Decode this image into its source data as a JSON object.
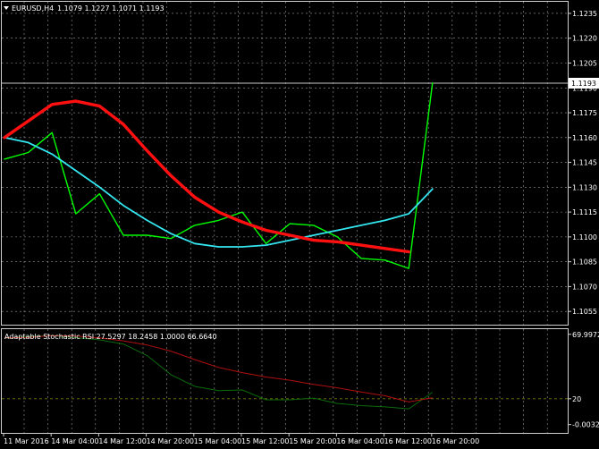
{
  "symbol_label": "EURUSD,H4",
  "ohlc_label": "1.1079 1.1227 1.1071 1.1193",
  "current_price_label": "1.1193",
  "indicator_title": "Adaptable Stochastic RSI 27.5297 18.2458 1.0000 66.6640",
  "colors": {
    "background": "#000000",
    "grid": "#9a9a9a",
    "price_line": "#00ff00",
    "cyan_ma": "#33e6f0",
    "red_ma": "#ff1010",
    "sub_green": "#0b6b0b",
    "sub_red": "#b01010",
    "level_line": "#7a7a00"
  },
  "chart_data": [
    {
      "type": "line",
      "title": "EURUSD,H4",
      "ylim": [
        1.1047,
        1.1242
      ],
      "y_ticks": [
        "1.1235",
        "1.1220",
        "1.1205",
        "1.1190",
        "1.1175",
        "1.1160",
        "1.1145",
        "1.1130",
        "1.1115",
        "1.1100",
        "1.1085",
        "1.1070",
        "1.1055"
      ],
      "series": [
        {
          "values": [
            1.1147,
            1.1151,
            1.1163,
            1.1114,
            1.1126,
            1.1101,
            1.1101,
            1.1099,
            1.1107,
            1.111,
            1.1115,
            1.1096,
            1.1108,
            1.1107,
            1.11,
            1.1087,
            1.1086,
            1.1081,
            1.1193
          ]
        },
        {
          "values": [
            1.116,
            1.1157,
            1.115,
            1.114,
            1.113,
            1.1119,
            1.111,
            1.1102,
            1.1096,
            1.1094,
            1.1094,
            1.1095,
            1.1098,
            1.1101,
            1.1104,
            1.1107,
            1.111,
            1.1114,
            1.1129
          ]
        },
        {
          "values": [
            1.116,
            1.117,
            1.118,
            1.1182,
            1.1179,
            1.1168,
            1.1152,
            1.1137,
            1.1124,
            1.1115,
            1.1109,
            1.1104,
            1.1101,
            1.1098,
            1.1097,
            1.1095,
            1.1093,
            1.1091
          ]
        }
      ]
    },
    {
      "type": "line",
      "title": "Adaptable Stochastic RSI 27.5297 18.2458 1.0000 66.6640",
      "ylim": [
        -6.5,
        74
      ],
      "y_ticks": [
        "69.9972",
        "20",
        "-0.0032"
      ],
      "levels": [
        20
      ],
      "series": [
        {
          "values": [
            67,
            68.3,
            68.9,
            67.4,
            65.7,
            62.5,
            53.5,
            38.7,
            29.6,
            26.3,
            26.8,
            19.2,
            19.2,
            20.5,
            16.3,
            14.7,
            13.7,
            12.2,
            25.0
          ]
        },
        {
          "values": [
            67.2,
            67.6,
            68.9,
            68.6,
            67.2,
            64.9,
            61.7,
            56.9,
            50.4,
            44.3,
            40.3,
            36.9,
            34.4,
            31.2,
            28.5,
            25.2,
            22.3,
            17.5,
            20.8
          ]
        }
      ]
    }
  ],
  "x_tick_labels": [
    "11 Mar 2016",
    "14 Mar 04:00",
    "14 Mar 12:00",
    "14 Mar 20:00",
    "15 Mar 04:00",
    "15 Mar 12:00",
    "15 Mar 20:00",
    "16 Mar 04:00",
    "16 Mar 12:00",
    "16 Mar 20:00"
  ]
}
